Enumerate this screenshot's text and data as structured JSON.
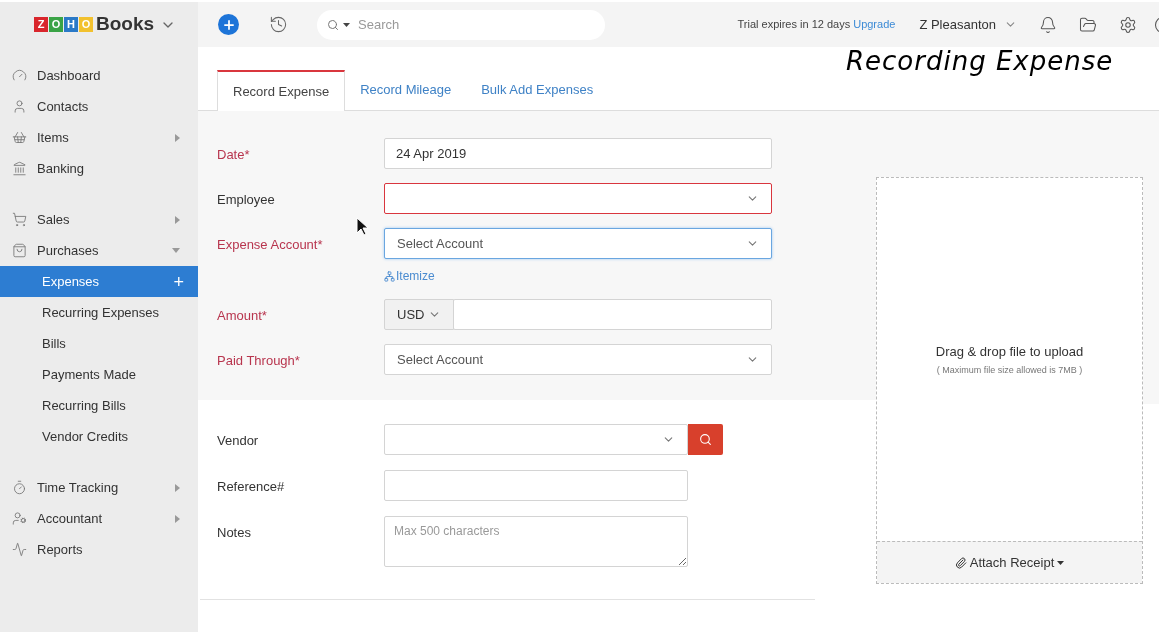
{
  "logo": {
    "letters": [
      {
        "char": "Z",
        "color": "#d9262c"
      },
      {
        "char": "O",
        "color": "#3aa346"
      },
      {
        "char": "H",
        "color": "#2a79c7"
      },
      {
        "char": "O",
        "color": "#f2c12e"
      }
    ],
    "name": "Books"
  },
  "topbar": {
    "search": {
      "placeholder": "Search"
    },
    "trial": "Trial expires in 12 days",
    "upgrade": "Upgrade",
    "user": "Z Pleasanton"
  },
  "caption": "Recording Expense",
  "sidebar": {
    "groups": [
      [
        {
          "label": "Dashboard",
          "selected": false
        },
        {
          "label": "Contacts",
          "selected": false
        },
        {
          "label": "Items",
          "expanded": false,
          "selected": false
        },
        {
          "label": "Banking",
          "selected": false
        }
      ],
      [
        {
          "label": "Sales",
          "expanded": false,
          "selected": false
        },
        {
          "label": "Purchases",
          "expanded": true,
          "selected": false,
          "children": [
            {
              "label": "Expenses",
              "selected": true,
              "add": "+"
            },
            {
              "label": "Recurring Expenses",
              "selected": false
            },
            {
              "label": "Bills",
              "selected": false
            },
            {
              "label": "Payments Made",
              "selected": false
            },
            {
              "label": "Recurring Bills",
              "selected": false
            },
            {
              "label": "Vendor Credits",
              "selected": false
            }
          ]
        }
      ],
      [
        {
          "label": "Time Tracking",
          "expanded": false,
          "selected": false
        },
        {
          "label": "Accountant",
          "expanded": false,
          "selected": false
        },
        {
          "label": "Reports",
          "selected": false
        }
      ]
    ]
  },
  "tabs": [
    {
      "label": "Record Expense",
      "selected": true
    },
    {
      "label": "Record Mileage",
      "selected": false
    },
    {
      "label": "Bulk Add Expenses",
      "selected": false
    }
  ],
  "form": {
    "top": [
      {
        "kind": "text",
        "label": "Date*",
        "required": true,
        "value": "24 Apr 2019",
        "invalid": false,
        "focused": false
      },
      {
        "kind": "select",
        "label": "Employee",
        "required": false,
        "invalid": true,
        "focused": false
      },
      {
        "kind": "select",
        "label": "Expense Account*",
        "required": true,
        "placeholder": "Select Account",
        "invalid": false,
        "focused": true,
        "link": "Itemize"
      },
      {
        "kind": "amount",
        "label": "Amount*",
        "required": true,
        "currency": "USD",
        "invalid": false,
        "focused": false
      },
      {
        "kind": "select",
        "label": "Paid Through*",
        "required": true,
        "placeholder": "Select Account",
        "invalid": false,
        "focused": false
      }
    ],
    "bottom": [
      {
        "kind": "vendor",
        "label": "Vendor",
        "required": false,
        "invalid": false,
        "focused": false
      },
      {
        "kind": "text",
        "label": "Reference#",
        "required": false,
        "invalid": false,
        "focused": false
      },
      {
        "kind": "textarea",
        "label": "Notes",
        "required": false,
        "placeholder": "Max 500 characters",
        "invalid": false,
        "focused": false
      }
    ]
  },
  "upload": {
    "title": "Drag & drop file to upload",
    "note": "( Maximum file size allowed is 7MB )",
    "button": "Attach Receipt"
  }
}
